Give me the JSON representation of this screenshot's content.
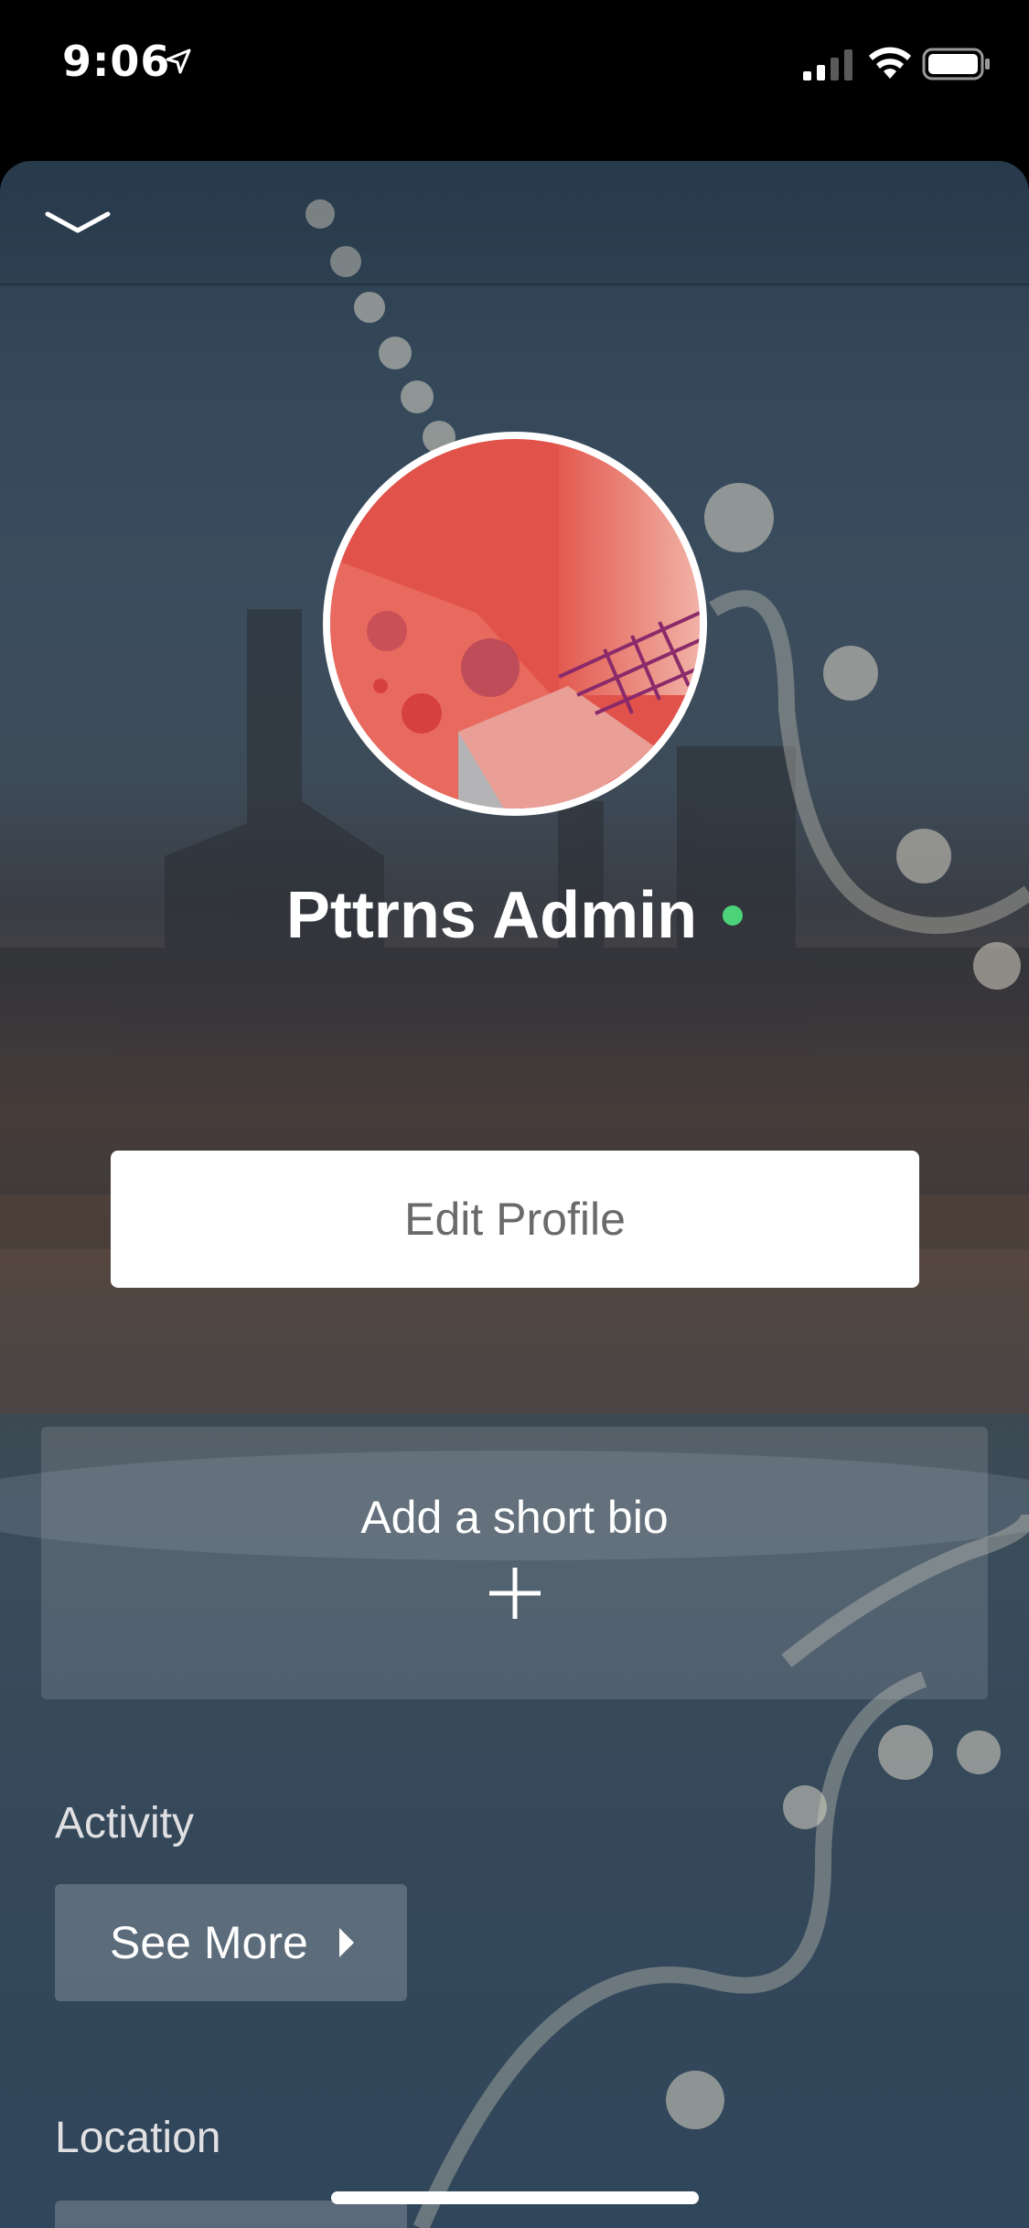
{
  "status_bar": {
    "time": "9:06",
    "icons": [
      "location-arrow-icon",
      "signal-icon",
      "wifi-icon",
      "battery-icon"
    ]
  },
  "header": {
    "collapse_icon": "chevron-down-icon"
  },
  "profile": {
    "name": "Pttrns Admin",
    "online_status_color": "#4cd37a",
    "avatar_icon": "abstract-geometric-avatar"
  },
  "edit_profile": {
    "label": "Edit Profile"
  },
  "bio": {
    "label": "Add a short bio",
    "icon": "plus-icon"
  },
  "activity": {
    "section_label": "Activity",
    "see_more_label": "See More",
    "see_more_icon": "caret-right-icon"
  },
  "location": {
    "section_label": "Location"
  },
  "colors": {
    "accent_online": "#4cd37a",
    "button_text": "#6a6a6a",
    "avatar_red": "#e0524a"
  }
}
